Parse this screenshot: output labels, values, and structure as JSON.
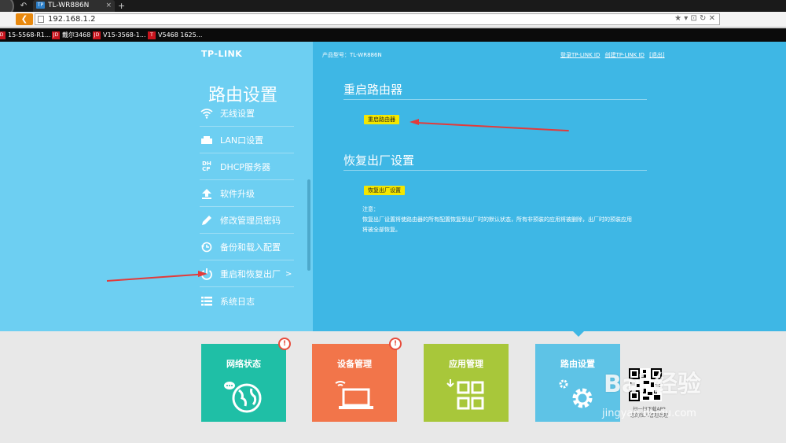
{
  "browser": {
    "tab_title": "TL-WR886N",
    "tab_favicon": "TP",
    "url": "192.168.1.2",
    "bookmarks": [
      {
        "icon": "D",
        "label": "15-5568-R1..."
      },
      {
        "icon": "JD",
        "label": "戴尔3468"
      },
      {
        "icon": "JD",
        "label": "V15-3568-1..."
      },
      {
        "icon": "T",
        "label": "V5468 1625..."
      }
    ]
  },
  "header": {
    "logo": "TP-LINK",
    "model": "产品型号：TL-WR886N",
    "login_link": "登录TP-LINK ID",
    "create_link": "创建TP-LINK ID",
    "logout_link": "[退出]"
  },
  "sidebar": {
    "title": "路由设置",
    "items": [
      {
        "label": "无线设置",
        "icon": "wifi-icon"
      },
      {
        "label": "LAN口设置",
        "icon": "lan-icon"
      },
      {
        "label": "DHCP服务器",
        "icon": "dhcp-icon"
      },
      {
        "label": "软件升级",
        "icon": "upgrade-icon"
      },
      {
        "label": "修改管理员密码",
        "icon": "pencil-icon"
      },
      {
        "label": "备份和载入配置",
        "icon": "backup-icon"
      },
      {
        "label": "重启和恢复出厂",
        "icon": "power-icon",
        "active": true,
        "arrow": ">"
      },
      {
        "label": "系统日志",
        "icon": "log-icon"
      }
    ]
  },
  "content": {
    "reboot_title": "重启路由器",
    "reboot_button": "重启路由器",
    "restore_title": "恢复出厂设置",
    "restore_button": "恢复出厂设置",
    "note_label": "注意：",
    "note_text_1": "恢复出厂设置将使路由器的所有配置恢复到出厂时的默认状态，所有非预装的应用将被删除，出厂时的预装应用",
    "note_text_2": "将被全部恢复。"
  },
  "tiles": [
    {
      "label": "网络状态",
      "color": "#1fbfa6",
      "icon": "globe-icon",
      "badge": "!"
    },
    {
      "label": "设备管理",
      "color": "#f2754a",
      "icon": "laptop-icon",
      "badge": "!"
    },
    {
      "label": "应用管理",
      "color": "#a8c73a",
      "icon": "apps-icon"
    },
    {
      "label": "路由设置",
      "color": "#5ec3e6",
      "icon": "gear-icon"
    }
  ],
  "qr": {
    "caption_1": "扫一扫下载APP",
    "caption_2": "您的私人管理助理"
  },
  "watermark": {
    "text": "Bai 经验",
    "sub": "jingyan.baidu.com"
  },
  "colors": {
    "sidebar_bg": "#6dcff2",
    "content_bg": "#3eb7e5",
    "button_yellow": "#f4e700",
    "annotation_arrow": "#e23b3b"
  }
}
